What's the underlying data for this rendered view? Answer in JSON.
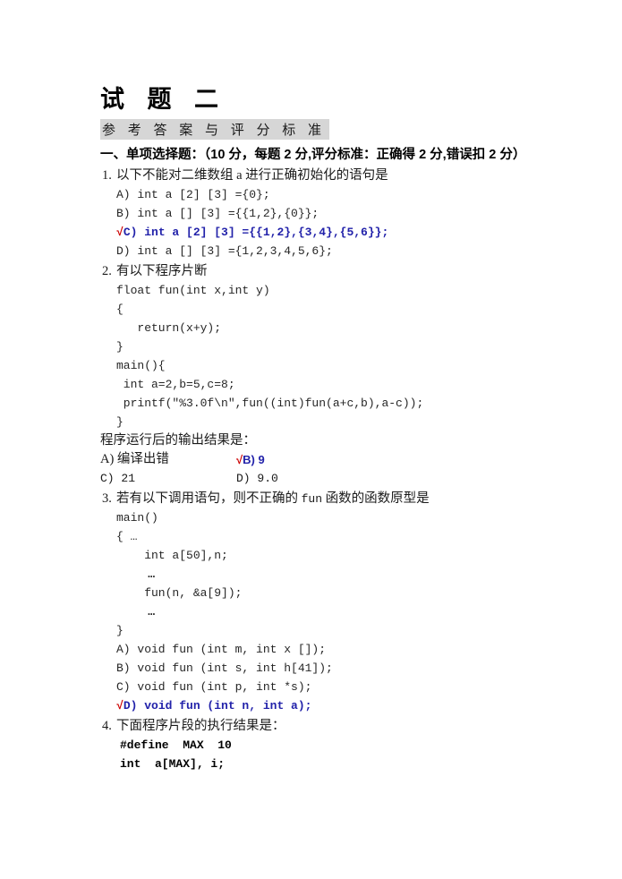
{
  "document": {
    "title": "试 题 二",
    "subtitle": "参 考 答 案 与 评 分 标 准",
    "section_heading": "一、单项选择题：（10 分，每题 2 分,评分标准：正确得 2 分,错误扣 2 分）"
  },
  "colors": {
    "answer_blue": "#2222aa",
    "tick_red": "#cc0000",
    "subtitle_highlight": "#d6d6d6",
    "body_text": "#1a1a1a"
  },
  "questions": [
    {
      "number": "1.",
      "stem": "以下不能对二维数组 a 进行正确初始化的语句是",
      "options": [
        {
          "tick": "",
          "text": "A) int a [2] [3] ={0};",
          "is_answer": false
        },
        {
          "tick": "",
          "text": "B) int a [] [3] ={{1,2},{0}};",
          "is_answer": false
        },
        {
          "tick": "√",
          "text": "C) int a [2] [3] ={{1,2},{3,4},{5,6}};",
          "is_answer": true
        },
        {
          "tick": "",
          "text": "D) int a [] [3] ={1,2,3,4,5,6};",
          "is_answer": false
        }
      ]
    },
    {
      "number": "2.",
      "stem": "有以下程序片断",
      "code": [
        "float fun(int x,int y)",
        "{",
        "   return(x+y);",
        "}",
        "main(){",
        " int a=2,b=5,c=8;",
        " printf(\"%3.0f\\n\",fun((int)fun(a+c,b),a-c));",
        "}"
      ],
      "prompt": "程序运行后的输出结果是：",
      "grid_options": [
        {
          "left_tick": "",
          "left": "A) 编译出错",
          "left_answer": false,
          "right_tick": "√",
          "right": "B) 9",
          "right_answer": true
        },
        {
          "left_tick": "",
          "left": "C) 21",
          "left_answer": false,
          "right_tick": "",
          "right": "D) 9.0",
          "right_answer": false
        }
      ]
    },
    {
      "number": "3.",
      "stem_pre": "若有以下调用语句，则不正确的 ",
      "stem_mono": "fun",
      "stem_post": " 函数的函数原型是",
      "code": [
        "main()",
        "{ …",
        "    int a[50],n;",
        "    …",
        "    fun(n, &a[9]);",
        "    …",
        "}"
      ],
      "options": [
        {
          "tick": "",
          "text": "A) void fun (int m, int x []);",
          "is_answer": false
        },
        {
          "tick": "",
          "text": "B) void fun (int s, int h[41]);",
          "is_answer": false
        },
        {
          "tick": "",
          "text": "C) void fun (int p, int *s);",
          "is_answer": false
        },
        {
          "tick": "√",
          "text": "D) void fun (int n, int a);",
          "is_answer": true
        }
      ]
    },
    {
      "number": "4.",
      "stem": "下面程序片段的执行结果是：",
      "code_bold": [
        "#define  MAX  10",
        "int  a[MAX], i;"
      ]
    }
  ]
}
